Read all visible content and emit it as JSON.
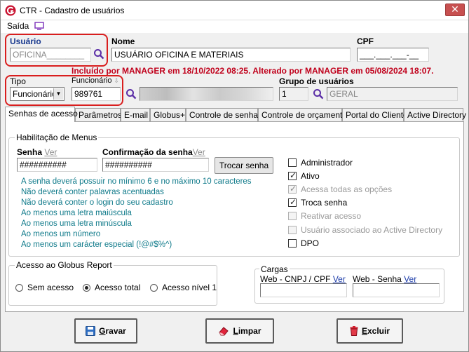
{
  "window": {
    "title": "CTR - Cadastro de usuários",
    "close_label": "✕"
  },
  "menu": {
    "saida": "Saída"
  },
  "fields": {
    "usuario_label": "Usuário",
    "usuario_value": "OFICINA________",
    "nome_label": "Nome",
    "nome_value": "USUÁRIO OFICINA E MATERIAIS",
    "cpf_label": "CPF",
    "cpf_value": "___.___.___-__",
    "tipo_label": "Tipo",
    "tipo_value": "Funcionário",
    "funcionario_label": "Funcionário",
    "funcionario_value": "989761",
    "grupo_label": "Grupo de usuários",
    "grupo_code": "1",
    "grupo_name": "GERAL"
  },
  "info_line": "Incluído por MANAGER em 18/10/2022 08:25. Alterado por MANAGER em 05/08/2024 18:07.",
  "tabs": [
    "Senhas de acesso",
    "Parâmetros",
    "E-mail",
    "Globus+",
    "Controle de senhas",
    "Controle de orçamento",
    "Portal do Cliente",
    "Active Directory"
  ],
  "habilitacao": {
    "title": "Habilitação de Menus",
    "senha_label": "Senha",
    "ver": "Ver",
    "senha_value": "##########",
    "confirmacao_label": "Confirmação da senha",
    "confirmacao_value": "##########",
    "trocar_label": "Trocar senha",
    "hints": [
      "A senha deverá possuir no mínimo 6 e no máximo 10 caracteres",
      "Não deverá conter palavras acentuadas",
      "Não deverá conter o login do seu cadastro",
      "Ao menos uma letra maiúscula",
      "Ao menos uma letra minúscula",
      "Ao menos um número",
      "Ao menos um carácter especial (!@#$%^)"
    ],
    "checkboxes": [
      {
        "label": "Administrador",
        "checked": false,
        "disabled": false
      },
      {
        "label": "Ativo",
        "checked": true,
        "disabled": false
      },
      {
        "label": "Acessa todas as opções",
        "checked": true,
        "disabled": true
      },
      {
        "label": "Troca senha",
        "checked": true,
        "disabled": false
      },
      {
        "label": "Reativar acesso",
        "checked": false,
        "disabled": true
      },
      {
        "label": "Usuário associado ao Active Directory",
        "checked": false,
        "disabled": true
      },
      {
        "label": "DPO",
        "checked": false,
        "disabled": false
      }
    ]
  },
  "globus_report": {
    "title": "Acesso ao Globus Report",
    "options": [
      "Sem acesso",
      "Acesso total",
      "Acesso nível 1"
    ],
    "selected": "Acesso total"
  },
  "cargas": {
    "title": "Cargas",
    "web_cnpj_label": "Web - CNPJ / CPF",
    "web_senha_label": "Web - Senha",
    "ver": "Ver",
    "web_cnpj_value": "",
    "web_senha_value": ""
  },
  "buttons": {
    "gravar_first": "G",
    "gravar_rest": "ravar",
    "limpar_first": "L",
    "limpar_rest": "impar",
    "excluir_first": "E",
    "excluir_rest": "xcluir"
  },
  "colors": {
    "highlight": "#d91e1e",
    "info_text": "#c0001b",
    "hint_text": "#0f7a8a",
    "accent_blue": "#1a3a8f",
    "search_icon": "#5b2ea6"
  }
}
